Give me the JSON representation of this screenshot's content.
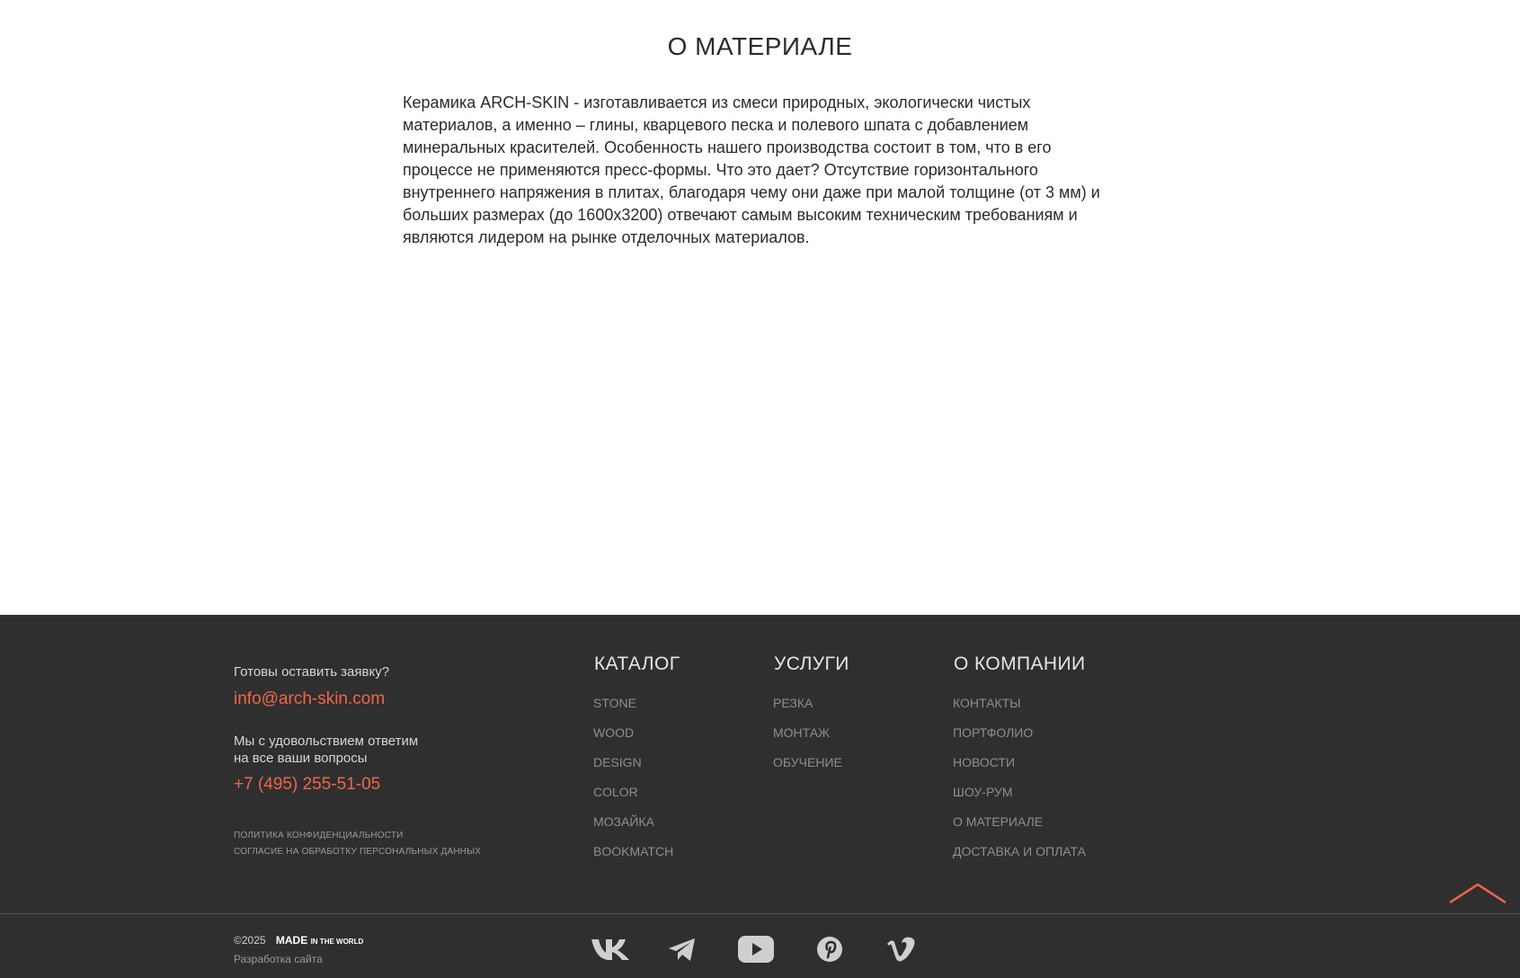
{
  "main": {
    "title": "О МАТЕРИАЛЕ",
    "text": "Керамика ARCH-SKIN - изготавливается из смеси природных, экологически чистых материалов, а именно – глины, кварцевого песка и полевого шпата с добавлением минеральных красителей. Особенность нашего производства состоит в том, что в его процессе не применяются пресс-формы. Что это дает? Отсутствие горизонтального внутреннего напряжения в плитах, благодаря чему они даже при малой толщине (от 3 мм) и больших размерах (до 1600х3200) отвечают самым высоким техническим требованиям и являются лидером на рынке отделочных материалов."
  },
  "footer": {
    "ready_text": "Готовы оставить заявку?",
    "email": "info@arch-skin.com",
    "answer_line1": "Мы с удовольствием ответим",
    "answer_line2": "на все ваши вопросы",
    "phone": "+7 (495) 255-51-05",
    "privacy": "ПОЛИТИКА КОНФИДЕНЦИАЛЬНОСТИ",
    "consent": "СОГЛАСИЕ НА ОБРАБОТКУ ПЕРСОНАЛЬНЫХ ДАННЫХ",
    "catalog": {
      "heading": "КАТАЛОГ",
      "items": [
        "STONE",
        "WOOD",
        "DESIGN",
        "COLOR",
        "МОЗАЙКА",
        "BOOKMATCH"
      ]
    },
    "services": {
      "heading": "УСЛУГИ",
      "items": [
        "РЕЗКА",
        "МОНТАЖ",
        "ОБУЧЕНИЕ"
      ]
    },
    "company": {
      "heading": "О КОМПАНИИ",
      "items": [
        "КОНТАКТЫ",
        "ПОРТФОЛИО",
        "НОВОСТИ",
        "ШОУ-РУМ",
        "О МАТЕРИАЛЕ",
        "ДОСТАВКА И ОПЛАТА"
      ]
    },
    "copyright": "©2025",
    "made_logo": "MADE",
    "made_logo_small": "IN THE WORLD",
    "dev_text": "Разработка сайта",
    "socials": [
      "vk-icon",
      "telegram-icon",
      "youtube-icon",
      "pinterest-icon",
      "vimeo-icon"
    ]
  },
  "colors": {
    "accent": "#ef6748",
    "footer_bg": "#2f2f2f",
    "icon_gray": "#cfcfcf"
  }
}
